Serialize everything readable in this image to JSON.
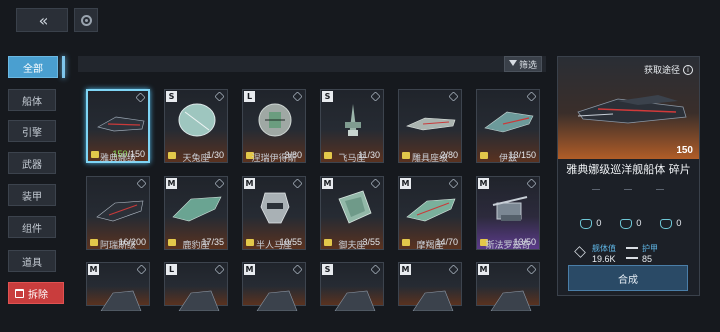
{
  "topbar": {
    "back_icon": "double-chevron-left-icon",
    "refresh_icon": "refresh-icon"
  },
  "sidebar": {
    "items": [
      {
        "label": "全部",
        "active": true
      },
      {
        "label": "船体"
      },
      {
        "label": "引擎"
      },
      {
        "label": "武器"
      },
      {
        "label": "装甲"
      },
      {
        "label": "组件"
      },
      {
        "label": "道具"
      }
    ],
    "dismantle_label": "拆除"
  },
  "filter": {
    "label": "筛选"
  },
  "cards": [
    {
      "name": "雅典娜级",
      "grade": "",
      "owned": "150",
      "total": "/150",
      "selected": true
    },
    {
      "name": "天兔座",
      "grade": "S",
      "owned": "1",
      "total": "/30"
    },
    {
      "name": "涅瑞伊得斯",
      "grade": "L",
      "owned": "3",
      "total": "/80"
    },
    {
      "name": "飞马座",
      "grade": "S",
      "owned": "11",
      "total": "/30"
    },
    {
      "name": "雕具座级",
      "grade": "",
      "owned": "2",
      "total": "/80"
    },
    {
      "name": "伊兹",
      "grade": "",
      "owned": "13",
      "total": "/150"
    },
    {
      "name": "阿瑞斯级",
      "grade": "",
      "owned": "16",
      "total": "/200"
    },
    {
      "name": "鹿豹座",
      "grade": "M",
      "owned": "17",
      "total": "/35"
    },
    {
      "name": "半人马座",
      "grade": "M",
      "owned": "10",
      "total": "/55"
    },
    {
      "name": "御夫座",
      "grade": "M",
      "owned": "3",
      "total": "/55"
    },
    {
      "name": "摩羯座",
      "grade": "M",
      "owned": "14",
      "total": "/70"
    },
    {
      "name": "斯法罗兹奇",
      "grade": "M",
      "owned": "13",
      "total": "/50",
      "purple": true
    },
    {
      "name": "",
      "grade": "M"
    },
    {
      "name": "",
      "grade": "L"
    },
    {
      "name": "",
      "grade": "M"
    },
    {
      "name": "",
      "grade": "S"
    },
    {
      "name": "",
      "grade": "M"
    },
    {
      "name": "",
      "grade": "M"
    }
  ],
  "detail": {
    "get_route_label": "获取途径",
    "count": "150",
    "title": "雅典娜级巡洋舰船体 碎片",
    "mini_stats": [
      "0",
      "0",
      "0"
    ],
    "hull_label": "舰体值",
    "hull_value": "19.6K",
    "armor_label": "护甲",
    "armor_value": "85",
    "synthesize_label": "合成"
  },
  "colors": {
    "accent": "#4a9fd0",
    "danger": "#c93d3d",
    "owned_full": "#8be05a",
    "card_glow": "#b15d28"
  }
}
